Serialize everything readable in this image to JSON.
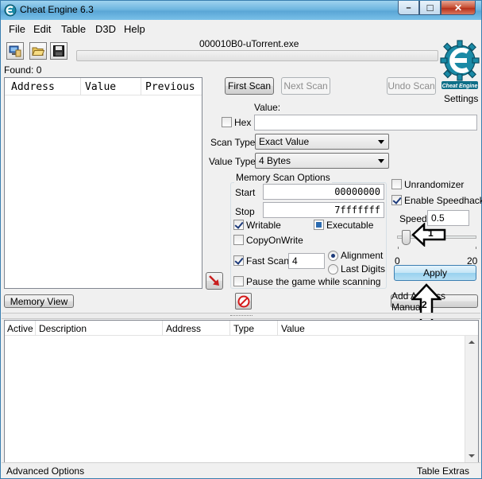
{
  "window": {
    "title": "Cheat Engine 6.3",
    "minimize_glyph": "–",
    "maximize_glyph": "□",
    "close_glyph": "✕"
  },
  "menu": [
    "File",
    "Edit",
    "Table",
    "D3D",
    "Help"
  ],
  "process": {
    "name": "000010B0-uTorrent.exe"
  },
  "found": "Found: 0",
  "settings_label": "Settings",
  "results_columns": [
    "Address",
    "Value",
    "Previous"
  ],
  "buttons": {
    "first_scan": "First Scan",
    "next_scan": "Next Scan",
    "undo_scan": "Undo Scan",
    "memory_view": "Memory View",
    "add_address": "Add Address Manually",
    "apply": "Apply"
  },
  "value_section": {
    "value_label": "Value:",
    "hex_label": "Hex",
    "value_input": ""
  },
  "scan_type": {
    "label": "Scan Type",
    "selected": "Exact Value"
  },
  "value_type": {
    "label": "Value Type",
    "selected": "4 Bytes"
  },
  "memory_scan_options": {
    "title": "Memory Scan Options",
    "start_label": "Start",
    "start_value": "00000000",
    "stop_label": "Stop",
    "stop_value": "7fffffff",
    "writable": "Writable",
    "executable": "Executable",
    "copy_on_write": "CopyOnWrite",
    "fast_scan": "Fast Scan",
    "fast_scan_value": "4",
    "alignment": "Alignment",
    "last_digits": "Last Digits",
    "pause_game": "Pause the game while scanning"
  },
  "speedhack": {
    "unrandomizer": "Unrandomizer",
    "enable_speedhack": "Enable Speedhack",
    "speed_label": "Speed",
    "speed_value": "0.5",
    "slider_min": "0",
    "slider_max": "20",
    "slider_value": 0.5
  },
  "annotations": {
    "arrow_1": "1",
    "arrow_2": "2"
  },
  "address_columns": [
    "Active",
    "Description",
    "Address",
    "Type",
    "Value"
  ],
  "statusbar": {
    "left": "Advanced Options",
    "right": "Table Extras"
  },
  "colors": {
    "titlebar": "#6fb6e0",
    "apply_blue": "#98d1ef",
    "logo_teal": "#1a8aa6"
  }
}
